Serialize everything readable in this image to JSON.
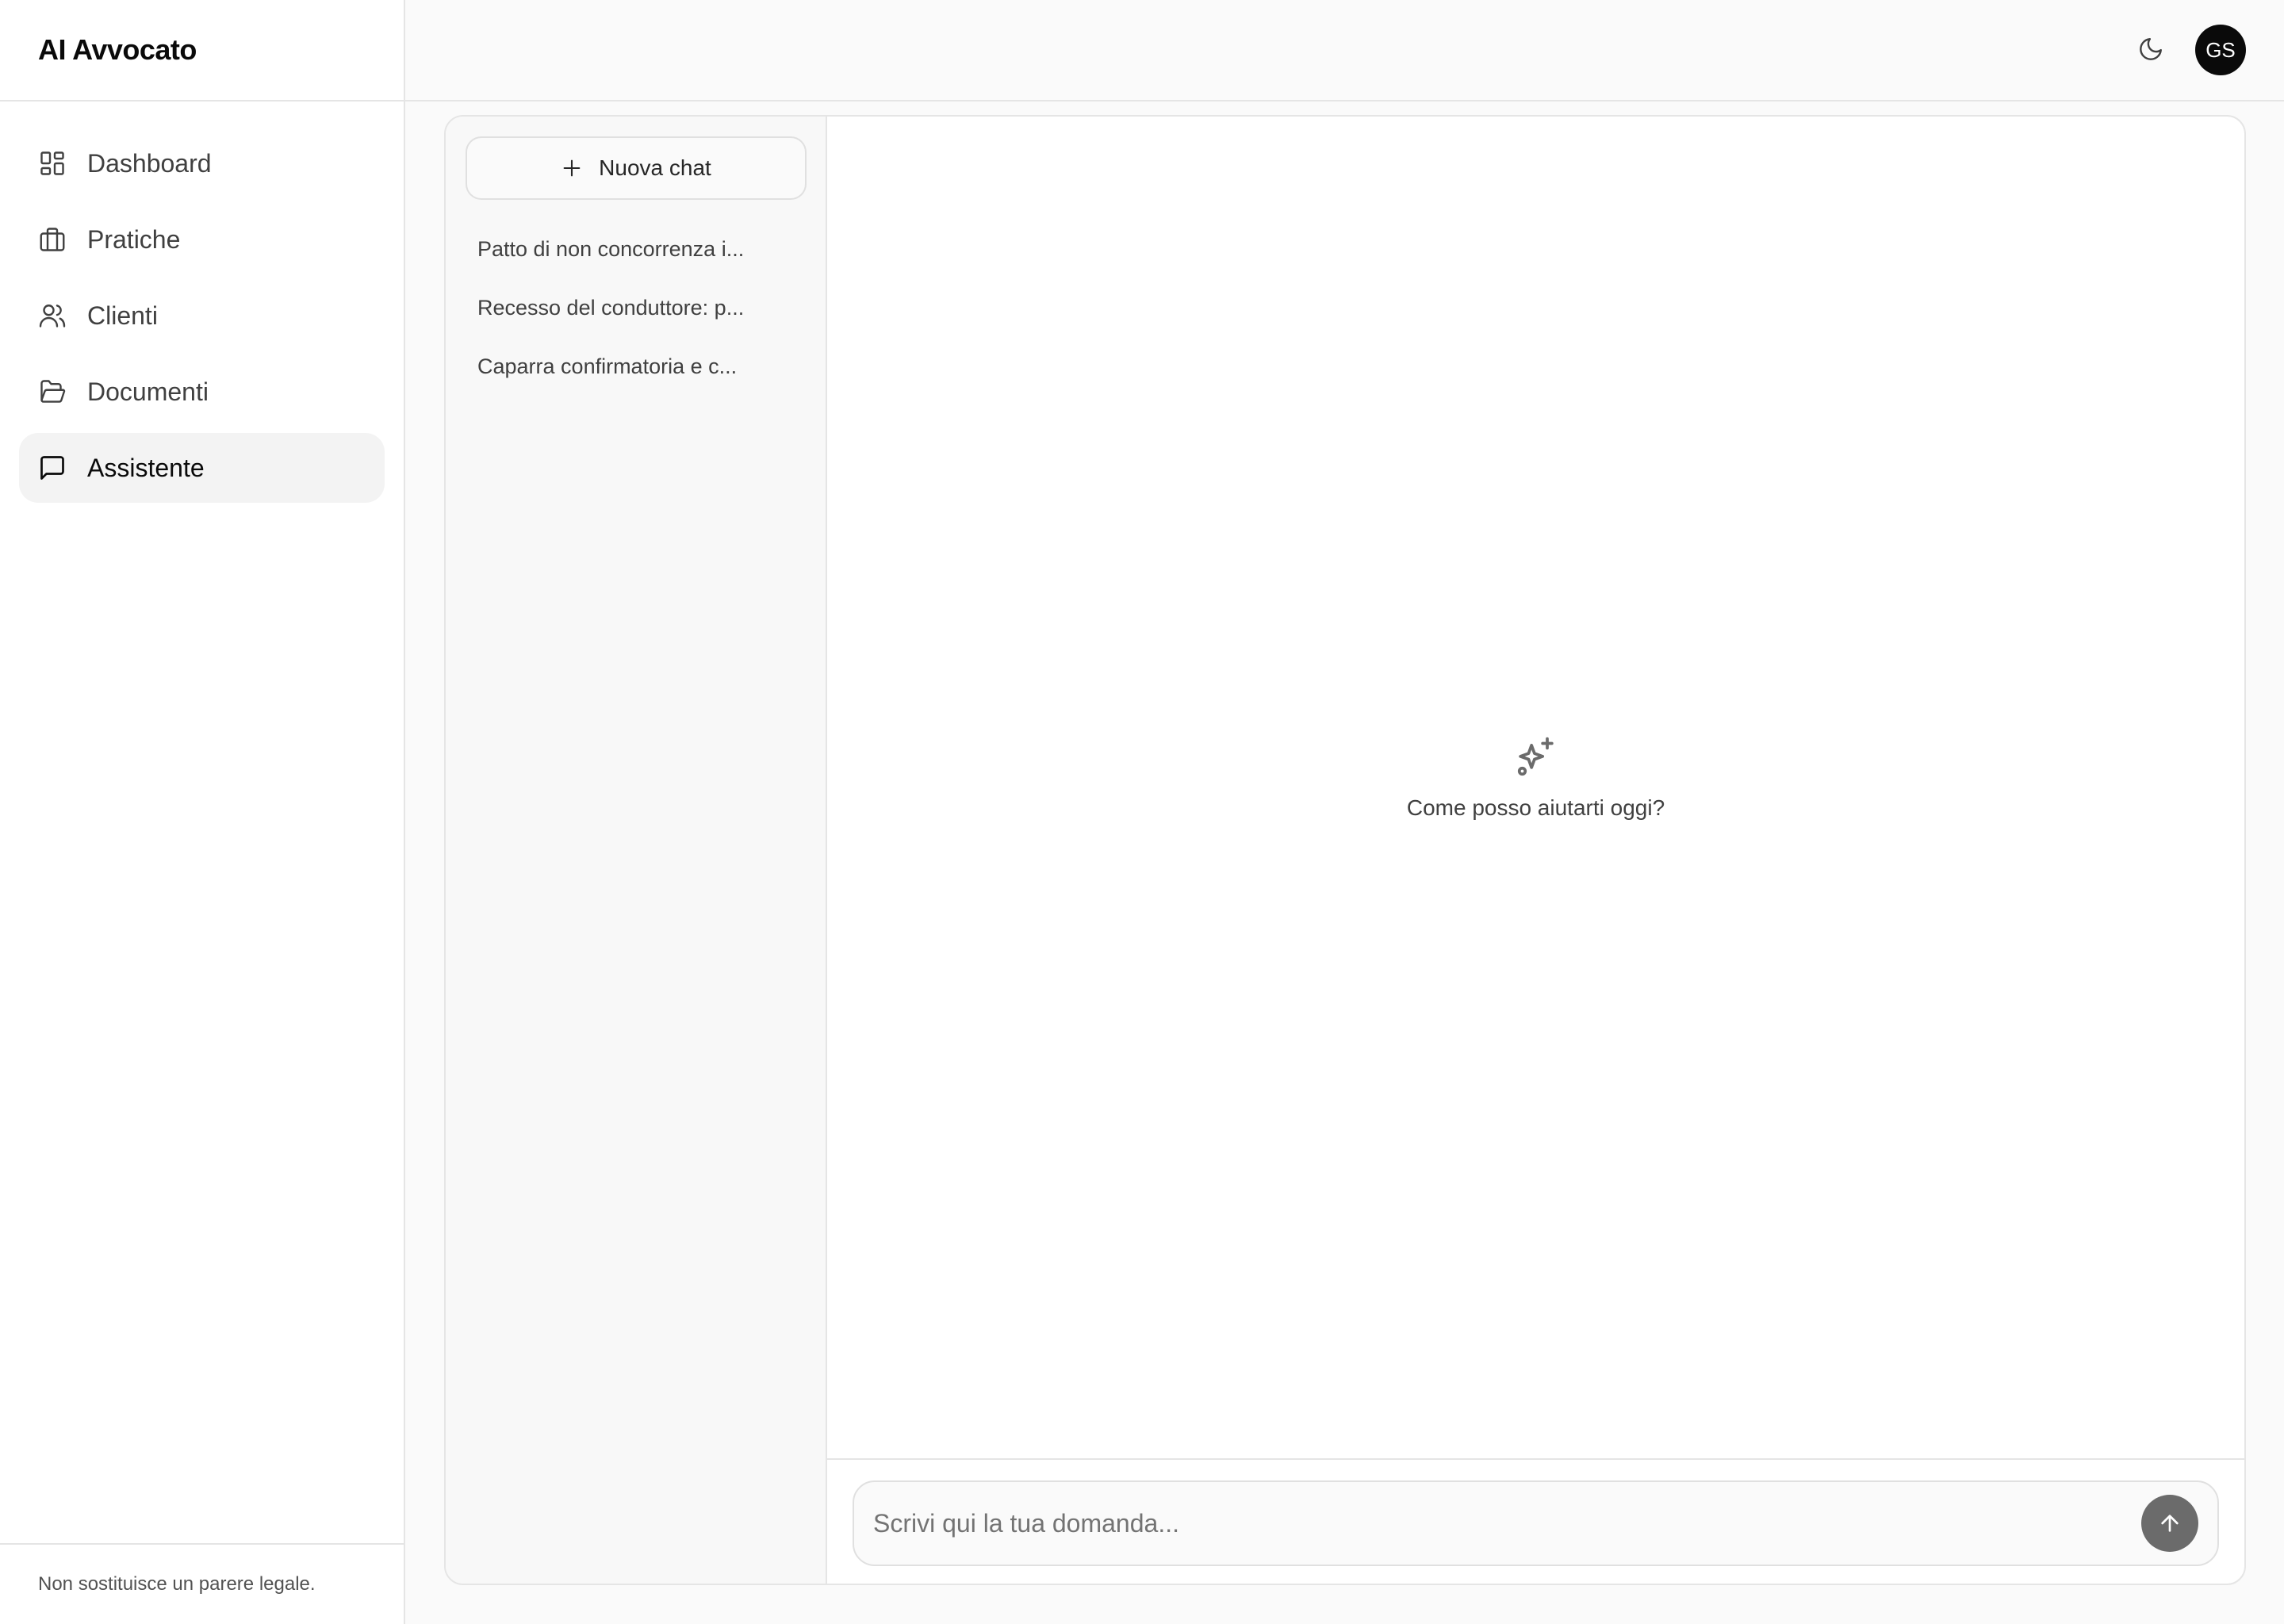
{
  "app": {
    "title": "AI Avvocato"
  },
  "sidebar": {
    "items": [
      {
        "label": "Dashboard",
        "icon": "dashboard-icon",
        "active": false
      },
      {
        "label": "Pratiche",
        "icon": "briefcase-icon",
        "active": false
      },
      {
        "label": "Clienti",
        "icon": "users-icon",
        "active": false
      },
      {
        "label": "Documenti",
        "icon": "folder-open-icon",
        "active": false
      },
      {
        "label": "Assistente",
        "icon": "message-square-icon",
        "active": true
      }
    ],
    "footer": "Non sostituisce un parere legale."
  },
  "header": {
    "theme_toggle_icon": "moon-icon",
    "avatar_initials": "GS"
  },
  "chat": {
    "new_chat_label": "Nuova chat",
    "history": [
      "Patto di non concorrenza i...",
      "Recesso del conduttore: p...",
      "Caparra confirmatoria e c..."
    ],
    "empty_prompt": "Come posso aiutarti oggi?",
    "input_placeholder": "Scrivi qui la tua domanda...",
    "input_value": ""
  },
  "colors": {
    "accent": "#0a0a0a",
    "send_button": "#6b6b6b",
    "active_nav_bg": "#f3f3f3"
  }
}
